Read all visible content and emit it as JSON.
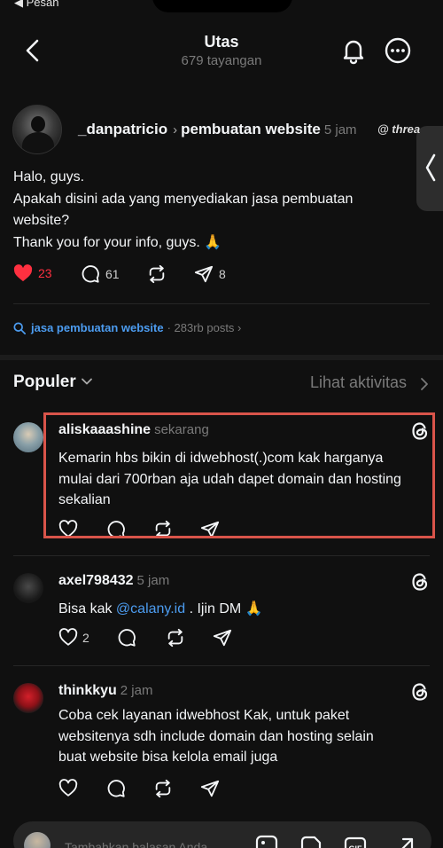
{
  "status": {
    "back_label": "◀ Pesan"
  },
  "nav": {
    "title": "Utas",
    "subtitle": "679 tayangan"
  },
  "post": {
    "username": "_danpatricio",
    "topic": "pembuatan website",
    "time": "5 jam",
    "app_tag": "threa",
    "lines": [
      "Halo, guys.",
      "Apakah disini ada yang menyediakan jasa pembuatan",
      "website?",
      "Thank you for your info, guys. 🙏"
    ],
    "likes": "23",
    "comments": "61",
    "shares": "8"
  },
  "topic_tag": {
    "label": "jasa pembuatan website",
    "count": "· 283rb posts ›"
  },
  "sort": {
    "label": "Populer",
    "activity": "Lihat aktivitas"
  },
  "replies": [
    {
      "username": "aliskaaashine",
      "time": "sekarang",
      "lines": [
        "Kemarin hbs bikin di idwebhost(.)com kak harganya",
        "mulai dari 700rban aja udah dapet domain dan hosting",
        "sekalian"
      ],
      "likes": ""
    },
    {
      "username": "axel798432",
      "time": "5 jam",
      "prefix": "Bisa kak ",
      "mention": "@calany.id",
      "suffix": " . Ijin DM 🙏",
      "likes": "2"
    },
    {
      "username": "thinkkyu",
      "time": "2 jam",
      "lines": [
        "Coba cek layanan idwebhost Kak, untuk paket",
        "websitenya sdh include domain dan hosting selain",
        "buat website bisa kelola email juga"
      ],
      "likes": ""
    }
  ],
  "compose": {
    "placeholder": "Tambahkan balasan Anda..."
  },
  "colors": {
    "accent": "#4c9cf0",
    "like": "#ff3040",
    "highlight": "#d9544a",
    "background": "#101010"
  },
  "icons": {
    "nav": [
      "back-chevron-icon",
      "bell-icon",
      "more-icon"
    ],
    "actions": [
      "heart-icon",
      "comment-icon",
      "repost-icon",
      "share-icon"
    ],
    "compose": [
      "image-icon",
      "sticker-icon",
      "gif-icon",
      "expand-icon"
    ]
  }
}
